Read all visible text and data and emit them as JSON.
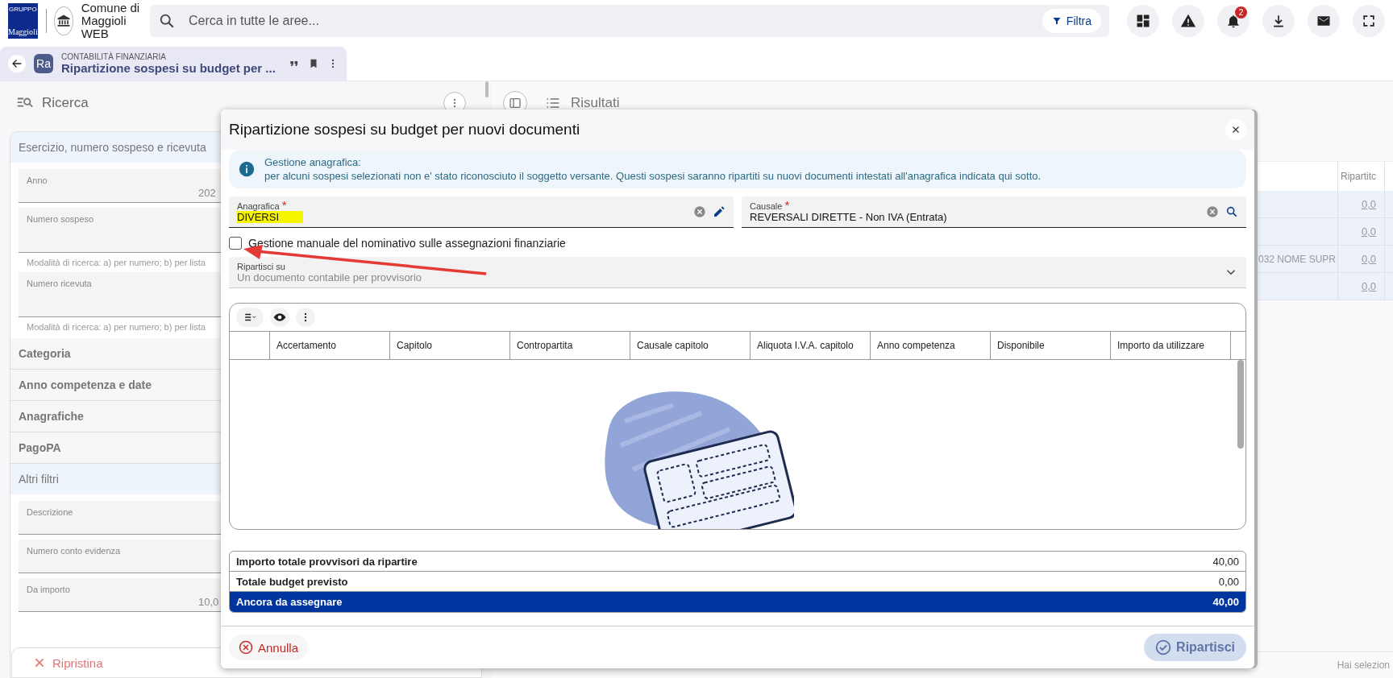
{
  "app_bar": {
    "logo_caption": "GRUPPO",
    "logo_text": "Maggioli",
    "org_name": "Comune di Maggioli WEB",
    "search": {
      "placeholder": "Cerca in tutte le aree..."
    },
    "filter_button": "Filtra",
    "notification_count": "2"
  },
  "tab": {
    "category": "CONTABILITÀ FINANZIARIA",
    "title": "Ripartizione sospesi su budget per ...",
    "badge": "Ra"
  },
  "search_panel": {
    "title": "Ricerca",
    "sections": [
      {
        "title": "Esercizio, numero sospeso e ricevuta",
        "expanded": true,
        "fields": [
          {
            "label": "Anno",
            "value": "202"
          },
          {
            "label": "Numero sospeso",
            "hint": "Modalità di ricerca: a) per numero; b) per lista"
          },
          {
            "label": "Numero ricevuta",
            "hint": "Modalità di ricerca: a) per numero; b) per lista"
          }
        ]
      },
      {
        "title": "Categoria",
        "expanded": false
      },
      {
        "title": "Anno competenza e date",
        "expanded": false
      },
      {
        "title": "Anagrafiche",
        "expanded": false
      },
      {
        "title": "PagoPA",
        "expanded": false
      },
      {
        "title": "Altri filtri",
        "expanded": true,
        "fields": [
          {
            "label": "Descrizione"
          },
          {
            "label": "Numero conto evidenza"
          },
          {
            "label": "Da importo",
            "value": "10,0"
          }
        ]
      }
    ],
    "reset_button": "Ripristina"
  },
  "results_panel": {
    "title": "Risultati",
    "columns": [
      "Ripartitc"
    ],
    "rows": [
      {
        "column_1": "",
        "column_2": "0,0"
      },
      {
        "column_1": "",
        "column_2": "0,0"
      },
      {
        "column_1": "032 NOME SUPR",
        "column_2": "0,0"
      },
      {
        "column_1": "",
        "column_2": "0,0"
      }
    ],
    "status": "Hai selezion"
  },
  "dialog": {
    "title": "Ripartizione sospesi su budget per nuovi documenti",
    "info": {
      "title": "Gestione anagrafica:",
      "text": "per alcuni sospesi selezionati non e' stato riconosciuto il soggetto versante. Questi sospesi saranno ripartiti su nuovi documenti intestati all'anagrafica indicata qui sotto."
    },
    "fields": [
      {
        "label": "Anagrafica",
        "required_mark": "*",
        "value": "DIVERSI",
        "highlighted": true,
        "kind": "edit"
      },
      {
        "label": "Causale",
        "required_mark": "*",
        "value": "REVERSALI DIRETTE - Non IVA (Entrata)",
        "highlighted": false,
        "kind": "search"
      }
    ],
    "manual_checkbox": {
      "label": "Gestione manuale del nominativo sulle assegnazioni finanziarie",
      "checked": false
    },
    "split_select": {
      "label": "Ripartisci su",
      "value": "Un documento contabile per provvisorio"
    },
    "grid": {
      "columns": [
        "Accertamento",
        "Capitolo",
        "Contropartita",
        "Causale capitolo",
        "Aliquota I.V.A. capitolo",
        "Anno competenza",
        "Disponibile",
        "Importo da utilizzare"
      ]
    },
    "totals": [
      {
        "label": "Importo totale provvisori da ripartire",
        "value": "40,00",
        "kind": "normal"
      },
      {
        "label": "Totale budget previsto",
        "value": "0,00",
        "kind": "normal"
      },
      {
        "label": "Ancora da assegnare",
        "value": "40,00",
        "kind": "emphasis"
      }
    ],
    "cancel_button": "Annulla",
    "confirm_button": {
      "label": "Ripartisci",
      "disabled": true
    }
  }
}
